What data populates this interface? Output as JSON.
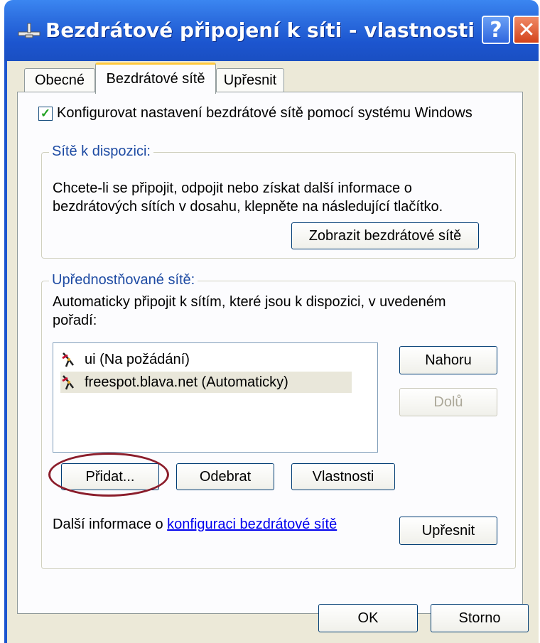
{
  "window": {
    "title": "Bezdrátové připojení k síti - vlastnosti",
    "help_glyph": "?",
    "close_glyph": "✕"
  },
  "tabs": [
    {
      "label": "Obecné",
      "active": false
    },
    {
      "label": "Bezdrátové sítě",
      "active": true
    },
    {
      "label": "Upřesnit",
      "active": false
    }
  ],
  "configure_checkbox": {
    "checked": true,
    "label": "Konfigurovat nastavení bezdrátové sítě pomocí systému Windows"
  },
  "available_networks": {
    "title": "Sítě k dispozici:",
    "description_line1": "Chcete-li se připojit, odpojit nebo získat další informace o",
    "description_line2": "bezdrátových sítích v dosahu, klepněte na následující tlačítko.",
    "show_button": "Zobrazit bezdrátové sítě"
  },
  "preferred_networks": {
    "title": "Upřednostňované sítě:",
    "description_line1": "Automaticky připojit k sítím, které jsou k dispozici, v uvedeném",
    "description_line2": "pořadí:",
    "items": [
      {
        "label": "ui (Na požádání)",
        "selected": false
      },
      {
        "label": "freespot.blava.net (Automaticky)",
        "selected": true
      }
    ],
    "up_button": "Nahoru",
    "down_button": "Dolů",
    "add_button": "Přidat...",
    "remove_button": "Odebrat",
    "properties_button": "Vlastnosti",
    "info_prefix": "Další informace o ",
    "info_link": "konfiguraci bezdrátové sítě",
    "advanced_button": "Upřesnit"
  },
  "footer": {
    "ok_button": "OK",
    "cancel_button": "Storno"
  },
  "colors": {
    "title_bar": "#1c55cf",
    "highlight_ellipse": "#8b1d2b",
    "group_title": "#1e4ba3"
  }
}
